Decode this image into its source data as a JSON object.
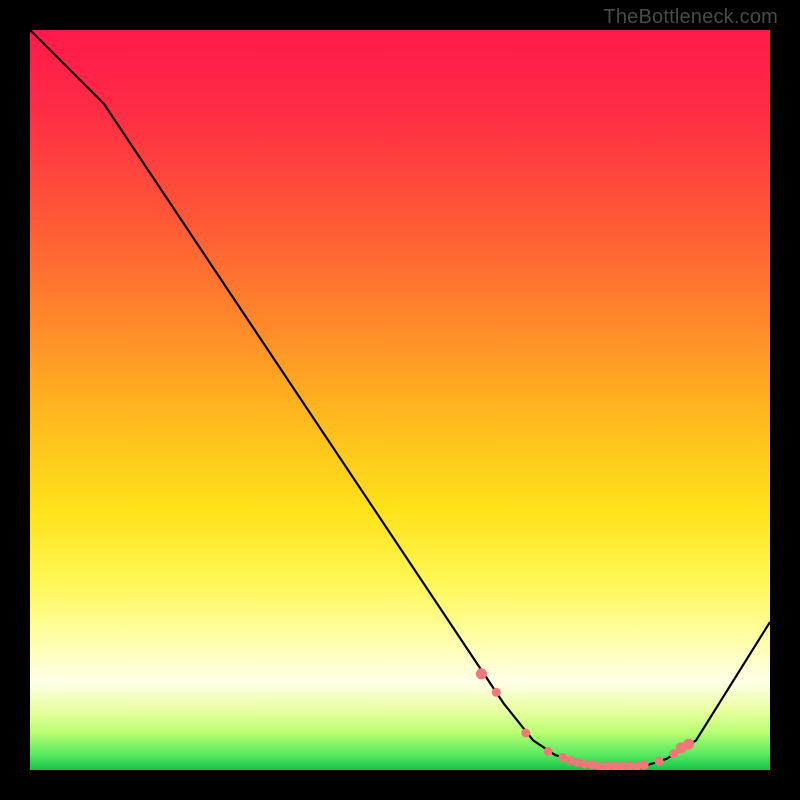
{
  "watermark": "TheBottleneck.com",
  "chart_data": {
    "type": "line",
    "title": "",
    "xlabel": "",
    "ylabel": "",
    "xlim": [
      0,
      100
    ],
    "ylim": [
      0,
      100
    ],
    "series": [
      {
        "name": "curve",
        "x": [
          0,
          6,
          10,
          60,
          64,
          68,
          71,
          77,
          83,
          86,
          90,
          100
        ],
        "y": [
          100,
          94,
          90,
          15,
          9,
          4,
          2,
          0.5,
          0.5,
          1.5,
          4,
          20
        ]
      }
    ],
    "markers": {
      "name": "highlight-points",
      "color": "#f07878",
      "x": [
        61,
        63,
        67,
        70,
        72,
        73,
        74,
        75,
        76,
        77,
        78,
        79,
        80,
        81,
        82,
        83,
        85,
        87,
        88,
        89
      ],
      "y": [
        13,
        10.5,
        5,
        2.5,
        1.7,
        1.3,
        1.0,
        0.8,
        0.7,
        0.5,
        0.5,
        0.5,
        0.5,
        0.5,
        0.5,
        0.7,
        1.2,
        2.2,
        3.0,
        3.5
      ]
    },
    "background": "heat-gradient"
  }
}
